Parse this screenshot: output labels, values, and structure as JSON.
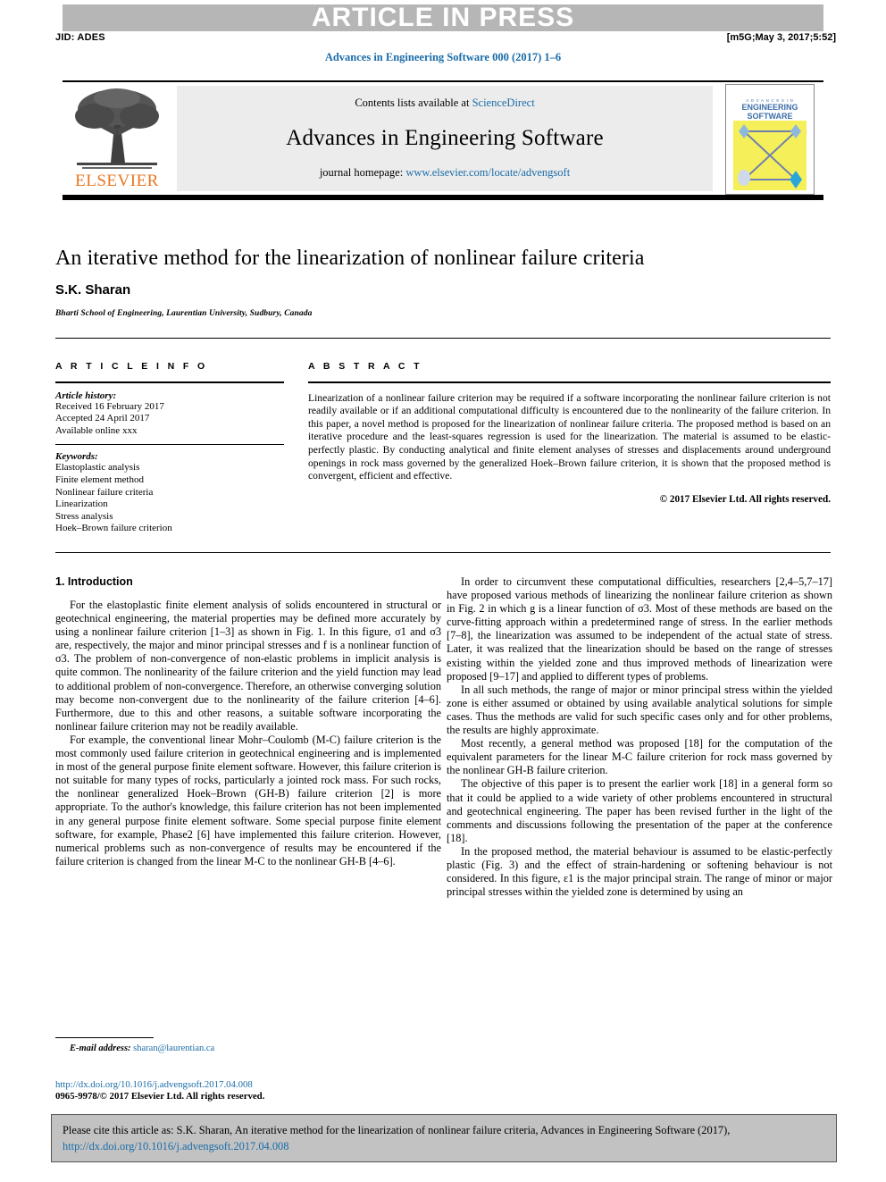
{
  "banner": {
    "article_in_press": "ARTICLE IN PRESS",
    "jid": "JID: ADES",
    "stamp": "[m5G;May 3, 2017;5:52]",
    "running_head": "Advances in Engineering Software 000 (2017) 1–6"
  },
  "masthead": {
    "publisher": "ELSEVIER",
    "contents_prefix": "Contents lists available at ",
    "contents_link": "ScienceDirect",
    "journal_title": "Advances in Engineering Software",
    "homepage_prefix": "journal homepage: ",
    "homepage_link": "www.elsevier.com/locate/advengsoft",
    "cover": {
      "line1": "A D V A N C E S   I N",
      "line2": "ENGINEERING",
      "line3": "SOFTWARE"
    }
  },
  "article": {
    "title": "An iterative method for the linearization of nonlinear failure criteria",
    "author": "S.K. Sharan",
    "affiliation": "Bharti School of Engineering, Laurentian University, Sudbury, Canada"
  },
  "info": {
    "heading": "A R T I C L E   I N F O",
    "history_label": "Article history:",
    "history": [
      "Received 16 February 2017",
      "Accepted 24 April 2017",
      "Available online xxx"
    ],
    "keywords_label": "Keywords:",
    "keywords": [
      "Elastoplastic analysis",
      "Finite element method",
      "Nonlinear failure criteria",
      "Linearization",
      "Stress analysis",
      "Hoek–Brown failure criterion"
    ]
  },
  "abstract": {
    "heading": "A B S T R A C T",
    "text": "Linearization of a nonlinear failure criterion may be required if a software incorporating the nonlinear failure criterion is not readily available or if an additional computational difficulty is encountered due to the nonlinearity of the failure criterion. In this paper, a novel method is proposed for the linearization of nonlinear failure criteria. The proposed method is based on an iterative procedure and the least-squares regression is used for the linearization. The material is assumed to be elastic-perfectly plastic. By conducting analytical and finite element analyses of stresses and displacements around underground openings in rock mass governed by the generalized Hoek–Brown failure criterion, it is shown that the proposed method is convergent, efficient and effective.",
    "copyright": "© 2017 Elsevier Ltd. All rights reserved."
  },
  "body": {
    "section_heading": "1. Introduction",
    "left_paragraphs": [
      "For the elastoplastic finite element analysis of solids encountered in structural or geotechnical engineering, the material properties may be defined more accurately by using a nonlinear failure criterion [1–3] as shown in Fig. 1. In this figure, σ1 and σ3 are, respectively, the major and minor principal stresses and f is a nonlinear function of σ3. The problem of non-convergence of non-elastic problems in implicit analysis is quite common. The nonlinearity of the failure criterion and the yield function may lead to additional problem of non-convergence. Therefore, an otherwise converging solution may become non-convergent due to the nonlinearity of the failure criterion [4–6]. Furthermore, due to this and other reasons, a suitable software incorporating the nonlinear failure criterion may not be readily available.",
      "For example, the conventional linear Mohr–Coulomb (M-C) failure criterion is the most commonly used failure criterion in geotechnical engineering and is implemented in most of the general purpose finite element software. However, this failure criterion is not suitable for many types of rocks, particularly a jointed rock mass. For such rocks, the nonlinear generalized Hoek–Brown (GH-B) failure criterion [2] is more appropriate. To the author's knowledge, this failure criterion has not been implemented in any general purpose finite element software. Some special purpose finite element software, for example, Phase2 [6] have implemented this failure criterion. However, numerical problems such as non-convergence of results may be encountered if the failure criterion is changed from the linear M-C to the nonlinear GH-B [4–6]."
    ],
    "right_paragraphs": [
      "In order to circumvent these computational difficulties, researchers [2,4–5,7–17] have proposed various methods of linearizing the nonlinear failure criterion as shown in Fig. 2 in which g is a linear function of σ3. Most of these methods are based on the curve-fitting approach within a predetermined range of stress. In the earlier methods [7–8], the linearization was assumed to be independent of the actual state of stress. Later, it was realized that the linearization should be based on the range of stresses existing within the yielded zone and thus improved methods of linearization were proposed [9–17] and applied to different types of problems.",
      "In all such methods, the range of major or minor principal stress within the yielded zone is either assumed or obtained by using available analytical solutions for simple cases. Thus the methods are valid for such specific cases only and for other problems, the results are highly approximate.",
      "Most recently, a general method was proposed [18] for the computation of the equivalent parameters for the linear M-C failure criterion for rock mass governed by the nonlinear GH-B failure criterion.",
      "The objective of this paper is to present the earlier work [18] in a general form so that it could be applied to a wide variety of other problems encountered in structural and geotechnical engineering. The paper has been revised further in the light of the comments and discussions following the presentation of the paper at the conference [18].",
      "In the proposed method, the material behaviour is assumed to be elastic-perfectly plastic (Fig. 3) and the effect of strain-hardening or softening behaviour is not considered. In this figure, ε1 is the major principal strain. The range of minor or major principal stresses within the yielded zone is determined by using an"
    ]
  },
  "footer": {
    "email_label": "E-mail address:",
    "email": "sharan@laurentian.ca",
    "doi": "http://dx.doi.org/10.1016/j.advengsoft.2017.04.008",
    "issn_line": "0965-9978/© 2017 Elsevier Ltd. All rights reserved."
  },
  "cite": {
    "prefix": "Please cite this article as: S.K. Sharan, An iterative method for the linearization of nonlinear failure criteria, Advances in Engineering Software (2017), ",
    "link": "http://dx.doi.org/10.1016/j.advengsoft.2017.04.008"
  },
  "colors": {
    "link": "#1a6ca8",
    "banner_gray": "#b6b6b6",
    "mast_gray": "#ececec",
    "cite_gray": "#c2c2c2",
    "elsevier_orange": "#e87722"
  }
}
